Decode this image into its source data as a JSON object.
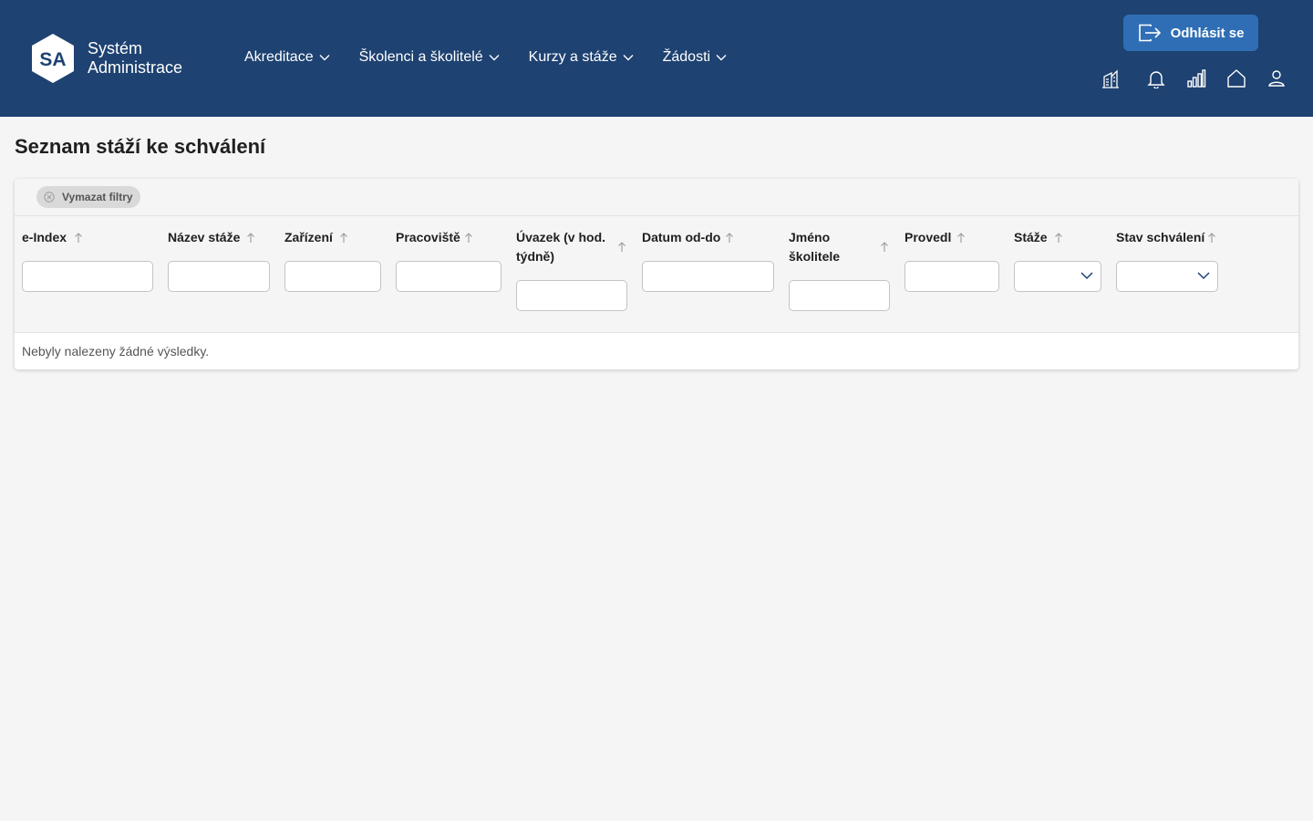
{
  "app": {
    "logo_initials": "SA",
    "logo_line1": "Systém",
    "logo_line2": "Administrace"
  },
  "nav": {
    "items": [
      {
        "label": "Akreditace"
      },
      {
        "label": "Školenci a školitelé"
      },
      {
        "label": "Kurzy a stáže"
      },
      {
        "label": "Žádosti"
      }
    ]
  },
  "header": {
    "logout_label": "Odhlásit se",
    "icons": [
      "building-icon",
      "bell-icon",
      "bar-chart-icon",
      "home-icon",
      "user-icon"
    ]
  },
  "page": {
    "title": "Seznam stáží ke schválení"
  },
  "table": {
    "clear_filters_label": "Vymazat filtry",
    "columns": [
      {
        "label": "e-Index",
        "filter": "text",
        "value": ""
      },
      {
        "label": "Název stáže",
        "filter": "text",
        "value": ""
      },
      {
        "label": "Zařízení",
        "filter": "text",
        "value": ""
      },
      {
        "label": "Pracoviště",
        "filter": "text",
        "value": ""
      },
      {
        "label": "Úvazek (v hod. týdně)",
        "label_line1": "Úvazek (v hod.",
        "label_line2": "týdně)",
        "filter": "text",
        "value": ""
      },
      {
        "label": "Datum od-do",
        "filter": "text",
        "value": ""
      },
      {
        "label": "Jméno školitele",
        "label_line1": "Jméno",
        "label_line2": "školitele",
        "filter": "text",
        "value": ""
      },
      {
        "label": "Provedl",
        "filter": "text",
        "value": ""
      },
      {
        "label": "Stáže",
        "filter": "select",
        "value": ""
      },
      {
        "label": "Stav schválení",
        "filter": "select",
        "value": ""
      }
    ],
    "empty_message": "Nebyly nalezeny žádné výsledky."
  },
  "colors": {
    "header_bg": "#1e4271",
    "logout_bg": "#2f6eb5",
    "page_bg": "#f5f5f5"
  }
}
